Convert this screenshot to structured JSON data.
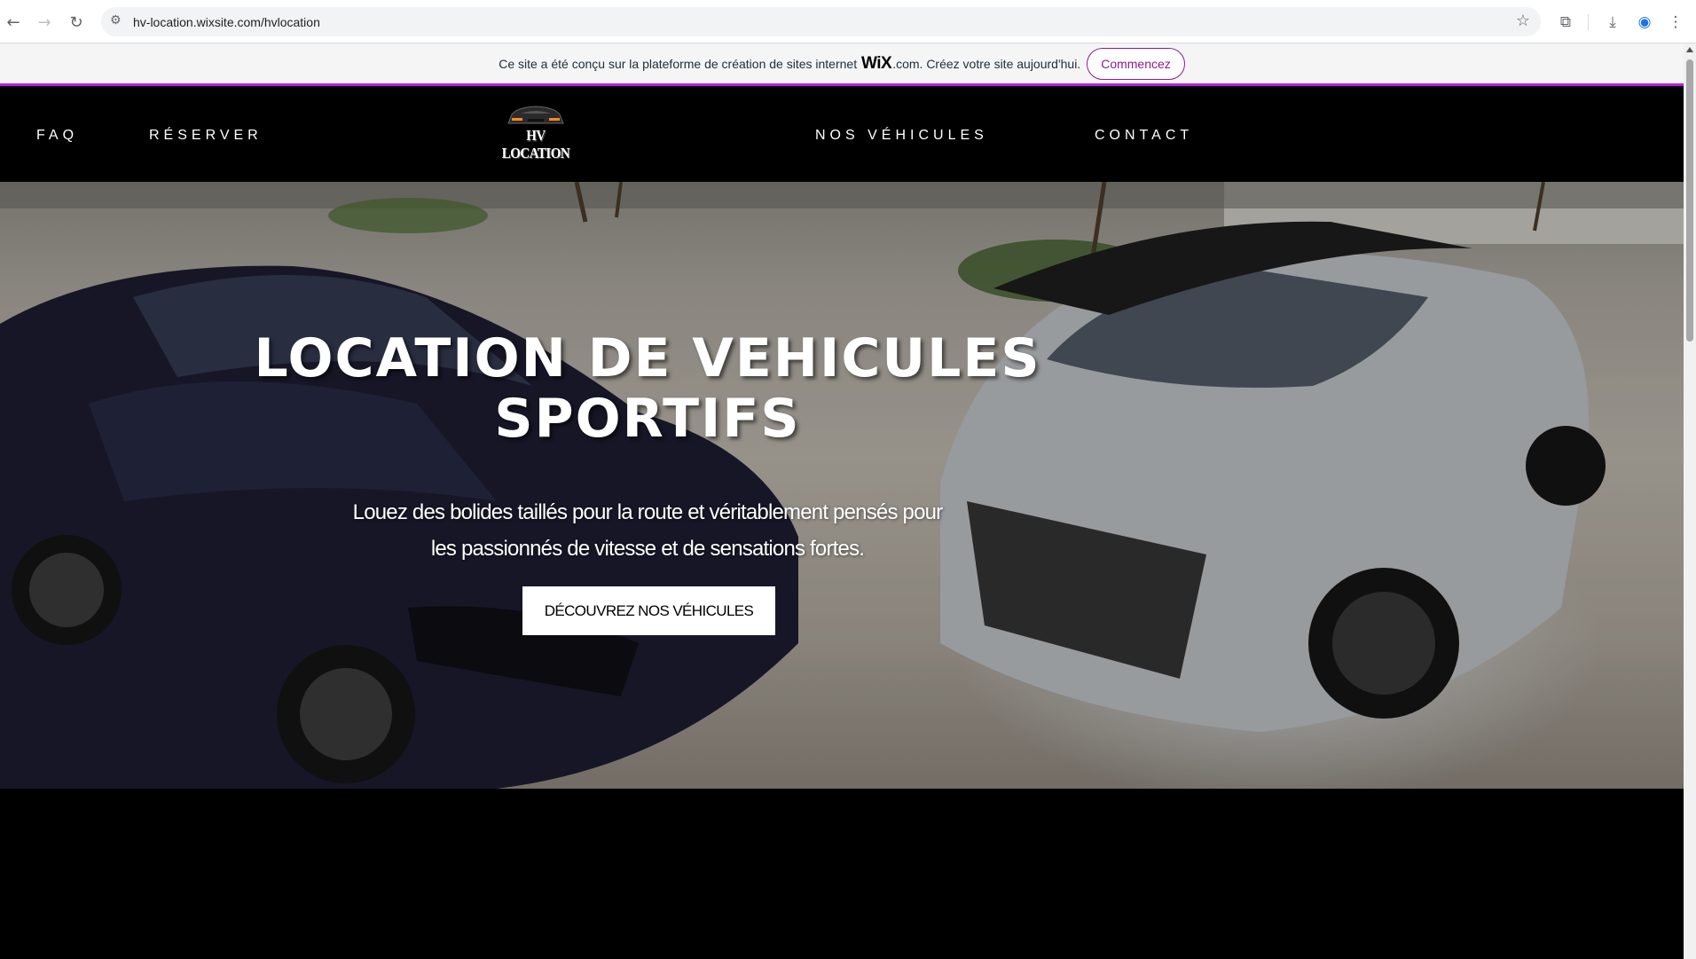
{
  "browser": {
    "url": "hv-location.wixsite.com/hvlocation",
    "back_icon": "arrow-left-icon",
    "forward_icon": "arrow-right-icon",
    "reload_icon": "reload-icon",
    "site_info_icon": "tune-icon",
    "bookmark_icon": "star-icon",
    "extensions_icon": "puzzle-icon",
    "download_icon": "download-icon",
    "profile_icon": "profile-icon",
    "menu_icon": "kebab-menu-icon"
  },
  "wix_banner": {
    "text_before": "Ce site a été conçu sur la plateforme de création de sites internet",
    "logo": "WiX",
    "text_after": ".com. Créez votre site aujourd'hui.",
    "button": "Commencez",
    "accent_color": "#b620e0"
  },
  "header": {
    "nav": {
      "faq": "FAQ",
      "reserver": "RÉSERVER",
      "vehicules": "NOS VÉHICULES",
      "contact": "CONTACT"
    },
    "logo_text": "HV LOCATION"
  },
  "hero": {
    "title_line1": "LOCATION DE VEHICULES",
    "title_line2": "SPORTIFS",
    "subtitle_line1": "Louez des bolides taillés pour la route et véritablement pensés pour",
    "subtitle_line2": "les passionnés de vitesse et de sensations fortes.",
    "cta": "DÉCOUVREZ NOS VÉHICULES",
    "image_description": "two-sport-cars-photo"
  }
}
